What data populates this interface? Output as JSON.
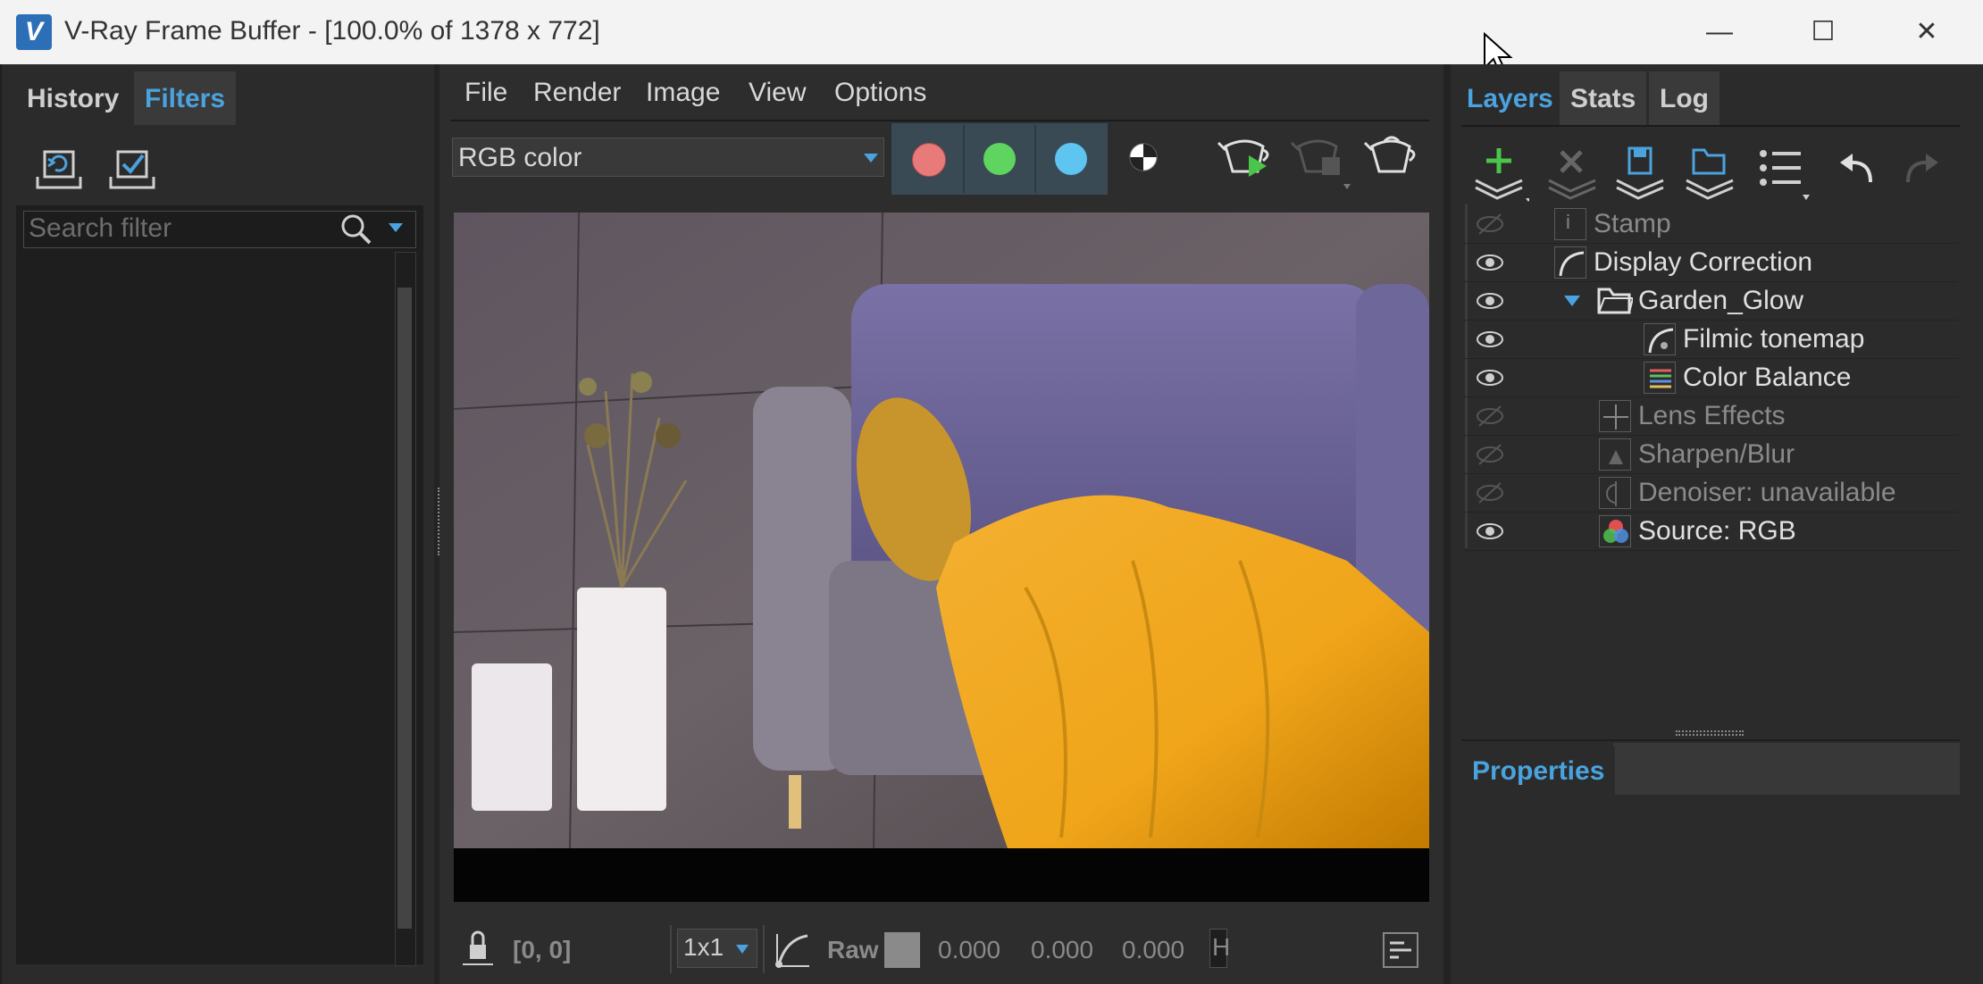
{
  "window": {
    "title": "V-Ray Frame Buffer - [100.0% of 1378 x 772]",
    "logo_text": "V",
    "min_glyph": "—",
    "max_glyph": "☐",
    "close_glyph": "✕"
  },
  "left_panel": {
    "tabs": [
      {
        "label": "History",
        "active": false
      },
      {
        "label": "Filters",
        "active": true
      }
    ],
    "search_placeholder": "Search filter"
  },
  "menu": [
    "File",
    "Render",
    "Image",
    "View",
    "Options"
  ],
  "toolbar": {
    "channel": "RGB color",
    "channel_buttons": [
      {
        "name": "red-channel",
        "color": "#e87a7a"
      },
      {
        "name": "green-channel",
        "color": "#5fd45f"
      },
      {
        "name": "blue-channel",
        "color": "#5ec4f0"
      }
    ]
  },
  "status": {
    "coords": "[0, 0]",
    "sampling": "1x1",
    "raw_label": "Raw",
    "r": "0.000",
    "g": "0.000",
    "b": "0.000",
    "trailing": "H"
  },
  "right_panel": {
    "tabs": [
      {
        "label": "Layers",
        "active": true
      },
      {
        "label": "Stats",
        "active": false
      },
      {
        "label": "Log",
        "active": false
      }
    ],
    "layers": [
      {
        "name": "Stamp",
        "visible": false,
        "icon": "stamp-icon"
      },
      {
        "name": "Display Correction",
        "visible": true,
        "icon": "curve-icon"
      },
      {
        "name": "Garden_Glow",
        "visible": true,
        "icon": "folder-icon"
      },
      {
        "name": "Filmic tonemap",
        "visible": true,
        "icon": "tonemap-icon"
      },
      {
        "name": "Color Balance",
        "visible": true,
        "icon": "color-balance-icon"
      },
      {
        "name": "Lens Effects",
        "visible": false,
        "icon": "lens-effects-icon"
      },
      {
        "name": "Sharpen/Blur",
        "visible": false,
        "icon": "sharpen-icon"
      },
      {
        "name": "Denoiser: unavailable",
        "visible": false,
        "icon": "denoiser-icon"
      },
      {
        "name": "Source: RGB",
        "visible": true,
        "icon": "source-rgb-icon"
      }
    ],
    "properties_label": "Properties"
  }
}
